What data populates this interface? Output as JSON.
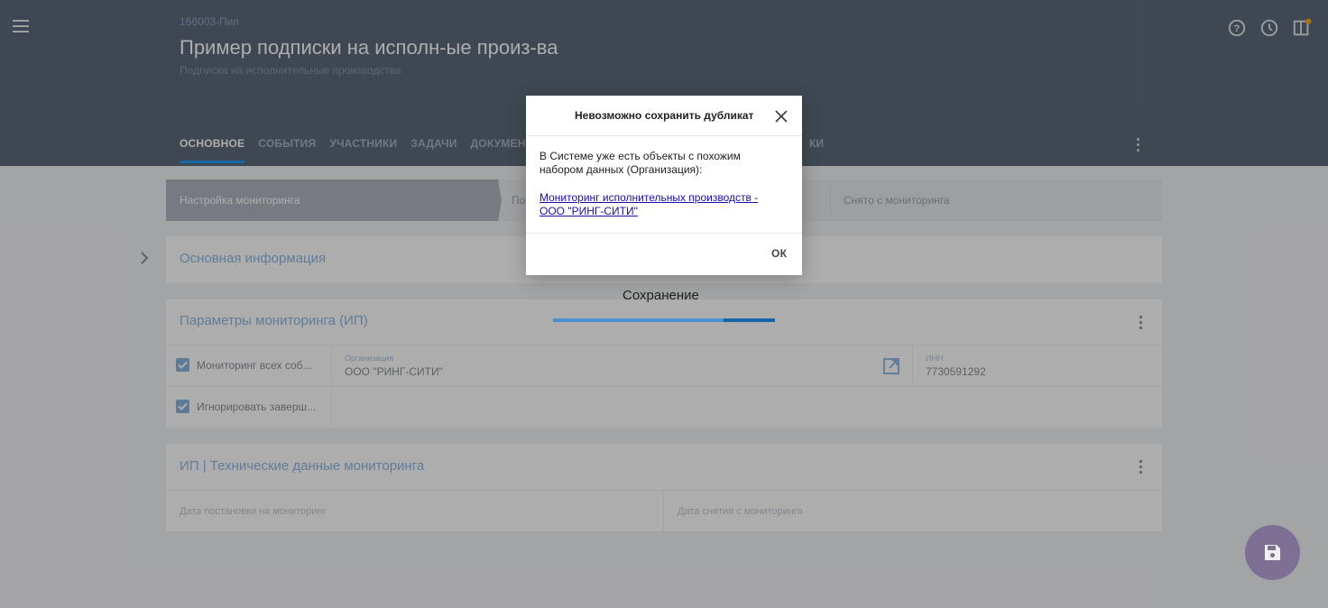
{
  "header": {
    "doc_id": "166003-Пип",
    "title": "Пример подписки на исполн-ые произ-ва",
    "subtitle": "Подписка на исполнительные производства",
    "tabs": [
      {
        "label": "ОСНОВНОЕ",
        "active": true
      },
      {
        "label": "СОБЫТИЯ"
      },
      {
        "label": "УЧАСТНИКИ"
      },
      {
        "label": "ЗАДАЧИ"
      },
      {
        "label": "ДОКУМЕНТЫ"
      }
    ],
    "tab_partial": "КИ",
    "icons": [
      "help-icon",
      "history-icon",
      "panel-notification-icon"
    ],
    "accent": "#2196f3"
  },
  "stepper": {
    "steps": [
      {
        "label": "Настройка мониторинга",
        "active": true
      },
      {
        "label": "По"
      },
      {
        "label": "Снято с мониторинга"
      }
    ]
  },
  "sections": {
    "basic": {
      "title": "Основная информация"
    },
    "params": {
      "title": "Параметры мониторинга (ИП)",
      "checkbox1_label": "Мониторинг всех соб...",
      "checkbox1_checked": true,
      "checkbox2_label": "Игнорировать заверш...",
      "checkbox2_checked": true,
      "org_label": "Организация",
      "org_value": "ООО \"РИНГ-СИТИ\"",
      "inn_label": "ИНН",
      "inn_value": "7730591292"
    },
    "tech": {
      "title": "ИП | Технические данные мониторинга",
      "date_start_placeholder": "Дата постановки на мониторинг",
      "date_end_placeholder": "Дата снятия с мониторинга"
    }
  },
  "saving": {
    "label": "Сохранение",
    "progress": 0.77
  },
  "dialog": {
    "title": "Невозможно сохранить дубликат",
    "message": "В Системе уже есть объекты с похожим набором данных (Организация):",
    "link": "Мониторинг исполнительных производств - ООО \"РИНГ-СИТИ\"",
    "ok_label": "ОК"
  }
}
